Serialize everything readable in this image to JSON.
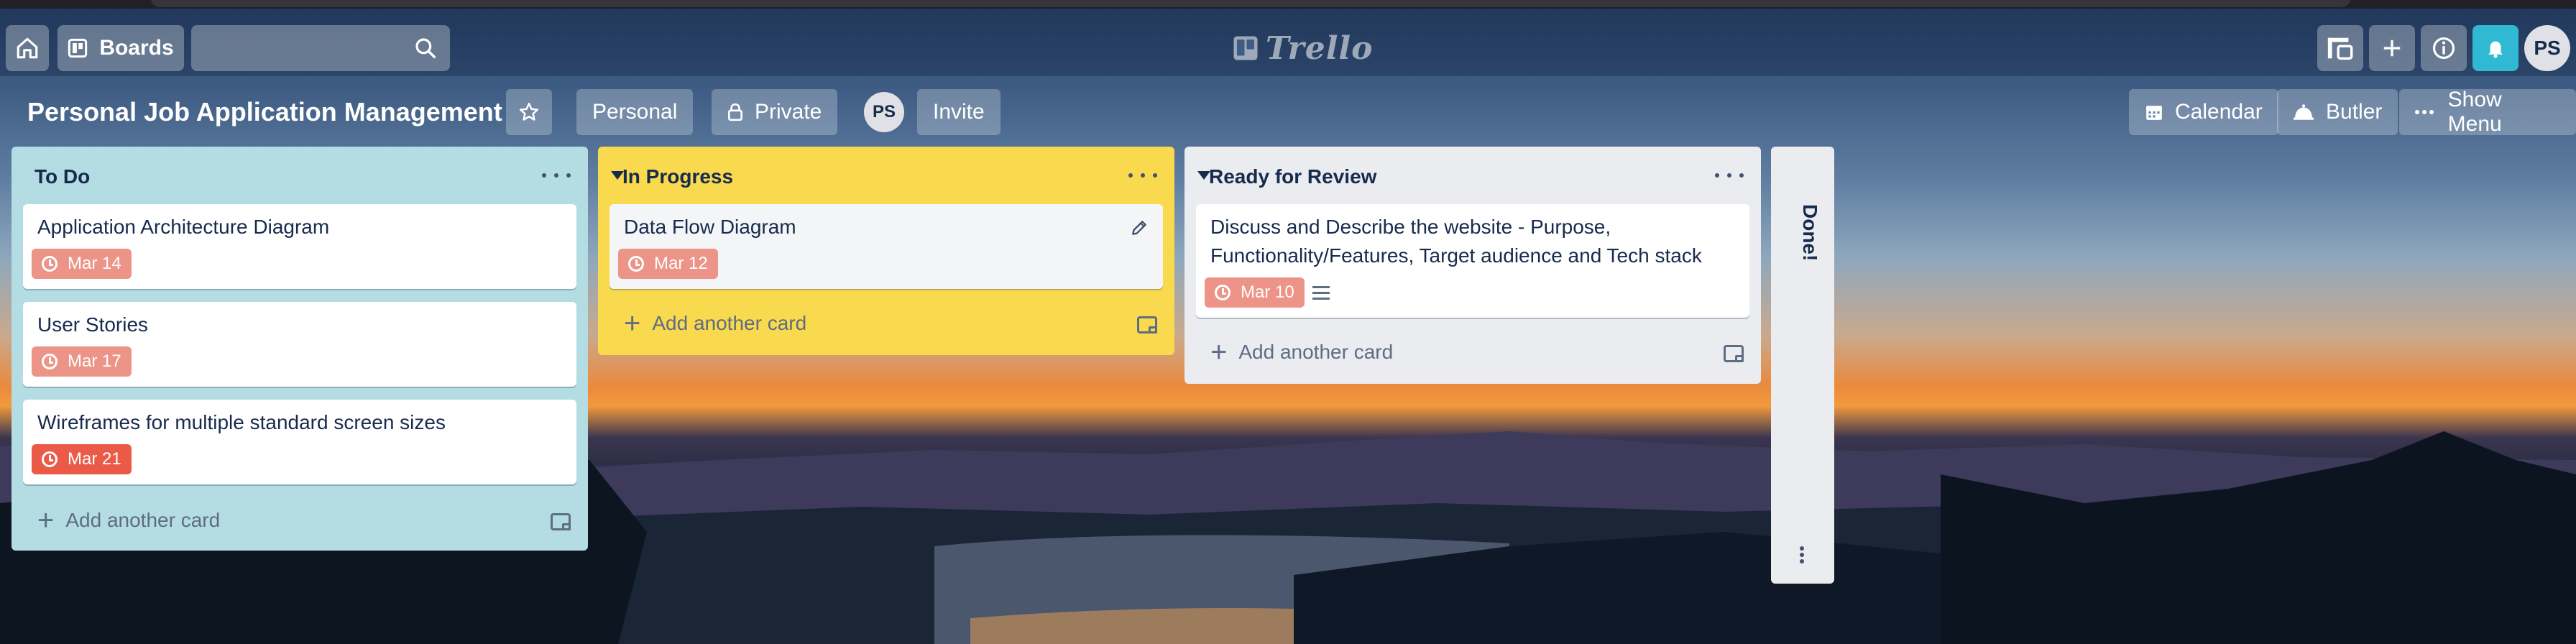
{
  "header": {
    "home_icon": "home-icon",
    "boards_label": "Boards",
    "search_icon": "search-icon",
    "logo_text": "Trello",
    "avatar_initials": "PS"
  },
  "board": {
    "title": "Personal Job Application Management",
    "visibility_team": "Personal",
    "visibility_private": "Private",
    "member_initials": "PS",
    "invite_label": "Invite",
    "calendar_label": "Calendar",
    "butler_label": "Butler",
    "show_menu_label": "Show Menu"
  },
  "lists": [
    {
      "title": "To Do",
      "color": "#b3dde3",
      "cards": [
        {
          "title": "Application Architecture Diagram",
          "due": "Mar 14",
          "due_color": "#ec9488"
        },
        {
          "title": "User Stories",
          "due": "Mar 17",
          "due_color": "#ec9488"
        },
        {
          "title": "Wireframes for multiple standard screen sizes",
          "due": "Mar 21",
          "due_color": "#eb5a46"
        }
      ],
      "add_label": "Add another card"
    },
    {
      "title": "In Progress",
      "color": "#f9d94d",
      "cards": [
        {
          "title": "Data Flow Diagram",
          "due": "Mar 12",
          "due_color": "#ec9488"
        }
      ],
      "add_label": "Add another card"
    },
    {
      "title": "Ready for Review",
      "color": "#ebecf0",
      "cards": [
        {
          "title": "Discuss and Describe the website - Purpose, Functionality/Features, Target audience and Tech stack",
          "due": "Mar 10",
          "due_color": "#ec9488"
        }
      ],
      "add_label": "Add another card"
    },
    {
      "title": "Done!",
      "collapsed": true
    }
  ]
}
